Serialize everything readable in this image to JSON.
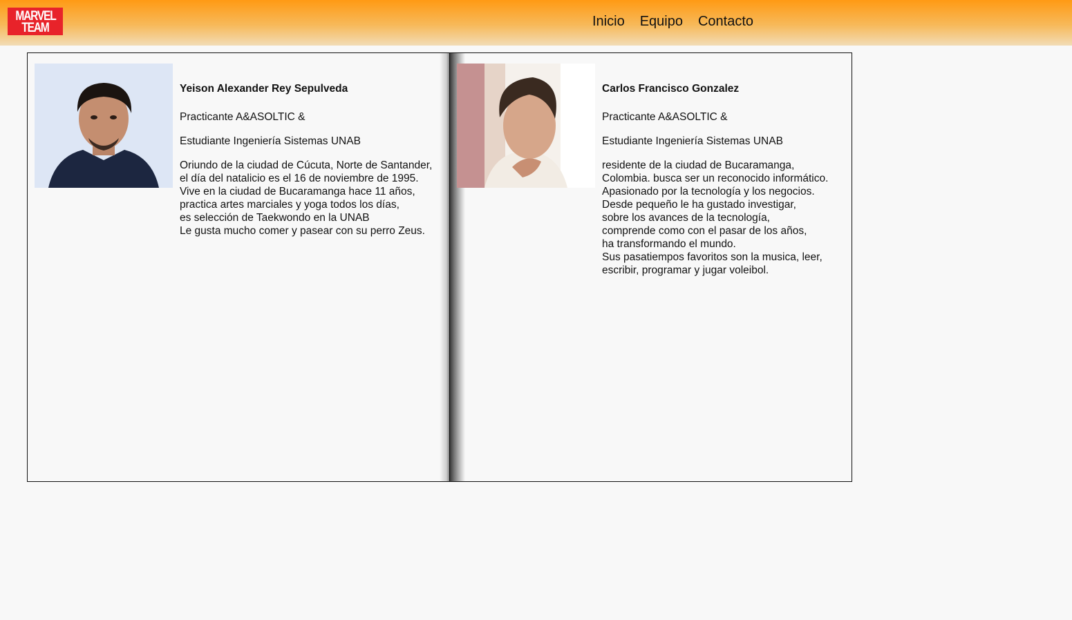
{
  "header": {
    "logo": {
      "line1": "MARVEL",
      "line2": "TEAM",
      "color": "#e8232a"
    },
    "nav": [
      "Inicio",
      "Equipo",
      "Contacto"
    ],
    "gradient": [
      "#ff9a14",
      "#f2dcb6"
    ]
  },
  "members": [
    {
      "name": "Yeison Alexander Rey Sepulveda",
      "role1": "Practicante A&ASOLTIC &",
      "role2": "Estudiante Ingeniería Sistemas UNAB",
      "bio": [
        "Oriundo de la ciudad de Cúcuta, Norte de Santander,",
        "el día del natalicio es el 16 de noviembre de 1995.",
        "Vive en la ciudad de Bucaramanga hace 11 años,",
        "practica artes marciales y yoga todos los días,",
        "es selección de Taekwondo en la UNAB",
        "Le gusta mucho comer y pasear con su perro Zeus."
      ]
    },
    {
      "name": "Carlos Francisco Gonzalez",
      "role1": "Practicante A&ASOLTIC &",
      "role2": "Estudiante Ingeniería Sistemas UNAB",
      "bio": [
        "residente de la ciudad de Bucaramanga,",
        "Colombia. busca ser un reconocido informático.",
        "Apasionado por la tecnología y los negocios.",
        "Desde pequeño le ha gustado investigar,",
        "sobre los avances de la tecnología,",
        "comprende como con el pasar de los años,",
        "ha transformando el mundo.",
        "Sus pasatiempos favoritos son la musica, leer,",
        "escribir, programar y jugar voleibol."
      ]
    }
  ]
}
